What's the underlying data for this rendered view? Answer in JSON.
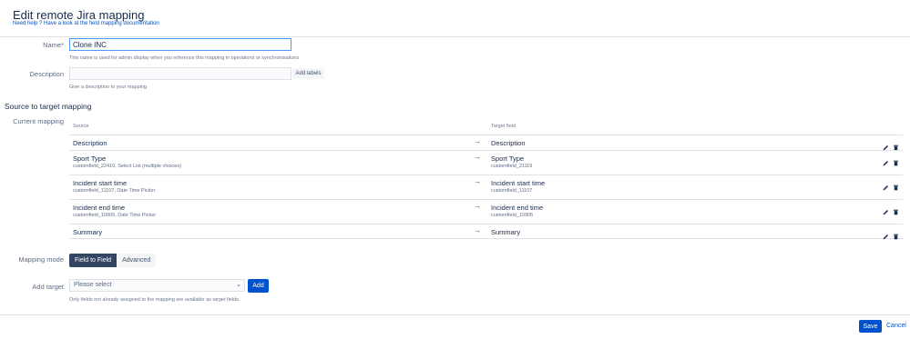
{
  "header": {
    "title": "Edit remote Jira mapping",
    "help_text": "Need help ? Have a look at the field mapping documentation"
  },
  "form": {
    "name_label": "Name*",
    "name_value": "Clone INC",
    "name_help": "This name is used for admin display when you reference this mapping in operations or synchronisations",
    "description_label": "Description",
    "description_value": "",
    "add_labels": "Add labels",
    "description_help": "Give a description to your mapping"
  },
  "section": {
    "title": "Source to target mapping"
  },
  "mapping": {
    "label": "Current mapping",
    "source_header": "Source",
    "target_header": "Target field",
    "arrow": "→",
    "rows": [
      {
        "source_name": "Description",
        "source_id": "",
        "target_name": "Description",
        "target_id": ""
      },
      {
        "source_name": "Sport Type",
        "source_id": "customfield_22410, Select List (multiple choices)",
        "target_name": "Sport Type",
        "target_id": "customfield_21119"
      },
      {
        "source_name": "Incident start time",
        "source_id": "customfield_11107, Date Time Picker",
        "target_name": "Incident start time",
        "target_id": "customfield_11107"
      },
      {
        "source_name": "Incident end time",
        "source_id": "customfield_10905, Date Time Picker",
        "target_name": "Incident end time",
        "target_id": "customfield_10905"
      },
      {
        "source_name": "Summary",
        "source_id": "",
        "target_name": "Summary",
        "target_id": ""
      }
    ],
    "row_icons": [
      "pencil-icon",
      "trash-icon"
    ]
  },
  "mode": {
    "label": "Mapping mode",
    "options": [
      "Field to Field",
      "Advanced"
    ],
    "selected": "Field to Field"
  },
  "add_target": {
    "label": "Add target",
    "placeholder": "Please select",
    "add_button": "Add",
    "help": "Only fields not already assigned to the mapping are available as target fields."
  },
  "footer": {
    "save": "Save",
    "cancel": "Cancel"
  },
  "colors": {
    "primary": "#0052cc",
    "dark_button": "#344563",
    "focus_border": "#4c9aff"
  }
}
